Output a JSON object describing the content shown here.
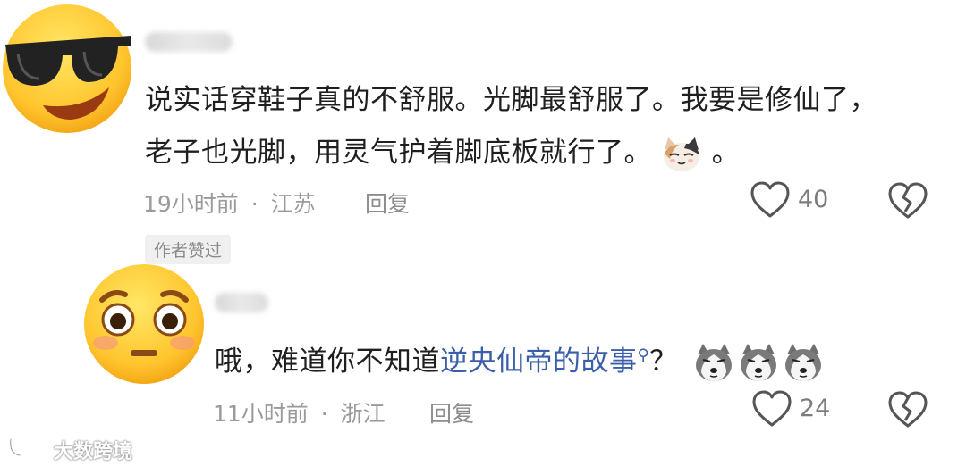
{
  "comments": [
    {
      "author": "",
      "text_line1": "说实话穿鞋子真的不舒服。光脚最舒服了。我要是修仙了，",
      "text_line2_a": "老子也光脚，用灵气护着脚底板就行了。",
      "text_line2_b": "。",
      "time": "19小时前",
      "location": "江苏",
      "reply_label": "回复",
      "likes": "40",
      "badge": "作者赞过"
    },
    {
      "author": "",
      "text_plain": "哦，难道你不知道",
      "text_link": "逆央仙帝的故事",
      "text_after": "？",
      "time": "11小时前",
      "location": "浙江",
      "reply_label": "回复",
      "likes": "24"
    }
  ],
  "meta_separator": "·",
  "watermark": "大数跨境",
  "icons": {
    "avatar1": "sunglasses-emoji-icon",
    "avatar2": "flushed-emoji-icon",
    "like": "heart-outline-icon",
    "dislike": "broken-heart-icon",
    "cat": "cat-emoji-icon",
    "dog": "husky-emoji-icon",
    "search": "search-icon"
  }
}
